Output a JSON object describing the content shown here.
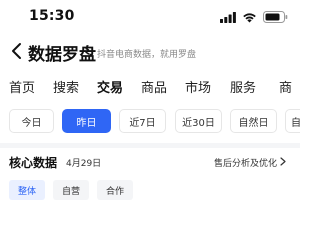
{
  "status_bar": {
    "time": "15:30"
  },
  "header": {
    "title": "数据罗盘",
    "subtitle": "抖音电商数据，就用罗盘",
    "back_icon": "chevron-left-icon"
  },
  "main_tabs": [
    {
      "label": "首页",
      "active": false
    },
    {
      "label": "搜索",
      "active": false
    },
    {
      "label": "交易",
      "active": true
    },
    {
      "label": "商品",
      "active": false
    },
    {
      "label": "市场",
      "active": false
    },
    {
      "label": "服务",
      "active": false
    },
    {
      "label": "商",
      "active": false
    }
  ],
  "date_filters": [
    {
      "label": "今日",
      "active": false
    },
    {
      "label": "昨日",
      "active": true
    },
    {
      "label": "近7日",
      "active": false
    },
    {
      "label": "近30日",
      "active": false
    },
    {
      "label": "自然日",
      "active": false
    },
    {
      "label": "自",
      "active": false
    }
  ],
  "core_data": {
    "title": "核心数据",
    "date": "4月29日",
    "link_label": "售后分析及优化"
  },
  "scope_filters": [
    {
      "label": "整体",
      "active": true
    },
    {
      "label": "自营",
      "active": false
    },
    {
      "label": "合作",
      "active": false
    }
  ],
  "colors": {
    "accent": "#2f66f5",
    "accent_light": "#eaf0ff",
    "divider": "#f4f5f7"
  }
}
